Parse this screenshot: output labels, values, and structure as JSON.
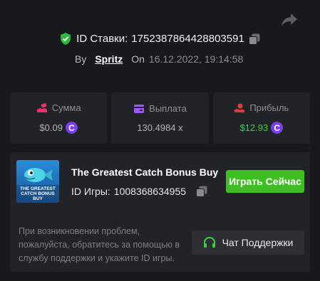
{
  "bet": {
    "id_label": "ID Ставки:",
    "id_value": "1752387864428803591",
    "by_label": "By",
    "username": "Spritz",
    "on_label": "On",
    "date": "16.12.2022, 19:14:58"
  },
  "stats": {
    "amount": {
      "label": "Сумма",
      "value": "$0.09",
      "icon": "hand-money-icon",
      "color": "#e8336b"
    },
    "payout": {
      "label": "Выплата",
      "value": "130.4984 x",
      "icon": "wallet-icon",
      "color": "#9b5cf6"
    },
    "profit": {
      "label": "Прибыль",
      "value": "$12.93",
      "icon": "money-hand-icon",
      "color": "#e03a3a",
      "value_color": "#3fcf43"
    },
    "coin_symbol": "C"
  },
  "game": {
    "thumb_text": "THE GREATEST CATCH BONUS BUY",
    "name": "The Greatest Catch Bonus Buy",
    "id_label": "ID Игры:",
    "id_value": "1008368634955",
    "play_label": "Играть Сейчас"
  },
  "support": {
    "help_text": "При возникновении проблем, пожалуйста, обратитесь за помощью в службу поддержки и укажите ID игры.",
    "chat_label": "Чат Поддержки"
  },
  "colors": {
    "background": "#18191d",
    "card": "#212328",
    "accent_green": "#3fbe23",
    "coin": "#7b3fe4"
  }
}
